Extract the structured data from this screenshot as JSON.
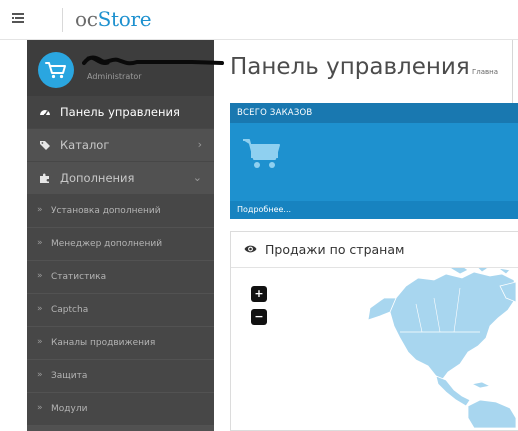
{
  "header": {
    "logo_oc": "oc",
    "logo_store": "Store"
  },
  "user": {
    "role": "Administrator"
  },
  "menu": {
    "items": [
      {
        "label": "Панель управления",
        "icon": "dashboard-icon",
        "active": true
      },
      {
        "label": "Каталог",
        "icon": "tags-icon",
        "has_submenu": true
      },
      {
        "label": "Дополнения",
        "icon": "puzzle-icon",
        "expanded": true
      }
    ],
    "submenu": [
      {
        "label": "Установка дополнений"
      },
      {
        "label": "Менеджер дополнений"
      },
      {
        "label": "Статистика"
      },
      {
        "label": "Captcha"
      },
      {
        "label": "Каналы продвижения"
      },
      {
        "label": "Защита"
      },
      {
        "label": "Модули"
      }
    ]
  },
  "page": {
    "title": "Панель управления",
    "breadcrumb": "Главна"
  },
  "orders_tile": {
    "heading": "ВСЕГО ЗАКАЗОВ",
    "footer_link": "Подробнее..."
  },
  "sales_panel": {
    "title": "Продажи по странам",
    "zoom_in": "+",
    "zoom_out": "−"
  },
  "colors": {
    "accent": "#1e91cf",
    "sidebar": "#515151",
    "sidebar_profile": "#3d3d3d",
    "map_land": "#a8d6ef"
  }
}
